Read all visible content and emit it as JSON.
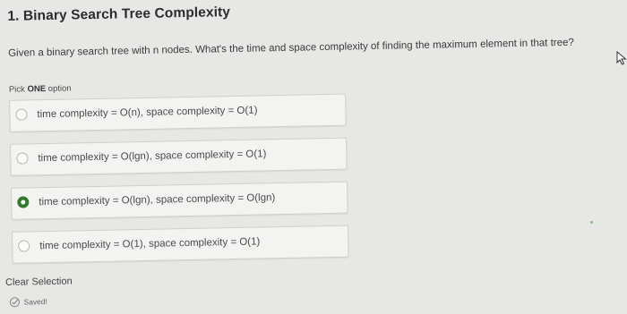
{
  "question": {
    "title": "1. Binary Search Tree Complexity",
    "text": "Given a binary search tree with n nodes. What's the time and space complexity of finding the maximum element in that tree?",
    "instruction_prefix": "Pick ",
    "instruction_bold": "ONE",
    "instruction_suffix": " option"
  },
  "options": [
    {
      "label": "time complexity = O(n), space complexity = O(1)",
      "selected": false
    },
    {
      "label": "time complexity = O(lgn), space complexity = O(1)",
      "selected": false
    },
    {
      "label": "time complexity = O(lgn), space complexity = O(lgn)",
      "selected": true
    },
    {
      "label": "time complexity = O(1), space complexity = O(1)",
      "selected": false
    }
  ],
  "footer": {
    "clear_label": "Clear Selection",
    "saved_label": "Saved!"
  },
  "colors": {
    "selected_radio": "#2f7a2c",
    "background": "#e7e7e5"
  },
  "icons": {
    "saved": "check-circle-icon",
    "cursor": "mouse-pointer-icon"
  }
}
